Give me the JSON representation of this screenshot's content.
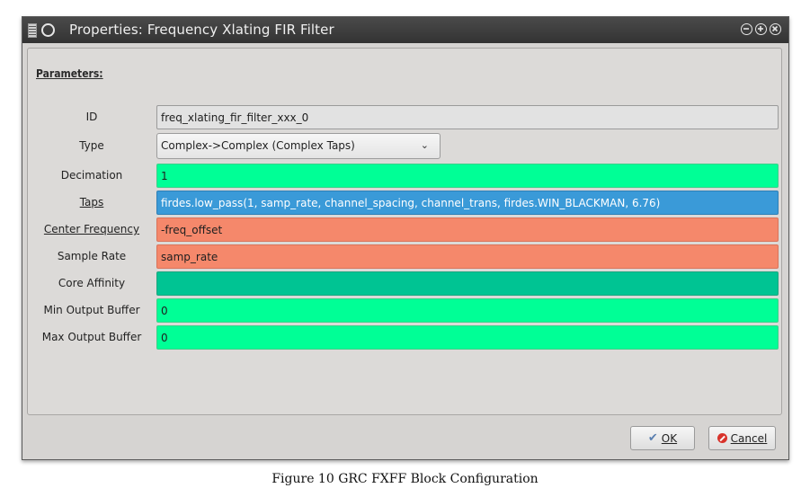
{
  "window": {
    "title": "Properties: Frequency Xlating FIR Filter"
  },
  "section": {
    "parameters_label": "Parameters:"
  },
  "params": [
    {
      "label": "ID",
      "value": "freq_xlating_fir_filter_xxx_0",
      "color": "#e2e2e2"
    },
    {
      "label": "Type",
      "value": "Complex->Complex (Complex Taps)"
    },
    {
      "label": "Decimation",
      "value": "1",
      "color": "#00ff96"
    },
    {
      "label": "Taps",
      "value": "firdes.low_pass(1, samp_rate, channel_spacing, channel_trans, firdes.WIN_BLACKMAN, 6.76)",
      "color": "#3a9ad8"
    },
    {
      "label": "Center Frequency",
      "value": "-freq_offset",
      "color": "#f5886b"
    },
    {
      "label": "Sample Rate",
      "value": "samp_rate",
      "color": "#f5886b"
    },
    {
      "label": "Core Affinity",
      "value": "",
      "color": "#00c493"
    },
    {
      "label": "Min Output Buffer",
      "value": "0",
      "color": "#00ff96"
    },
    {
      "label": "Max Output Buffer",
      "value": "0",
      "color": "#00ff96"
    }
  ],
  "buttons": {
    "ok_label": "OK",
    "cancel_label": "Cancel"
  },
  "caption": "Figure 10 GRC FXFF Block Configuration"
}
